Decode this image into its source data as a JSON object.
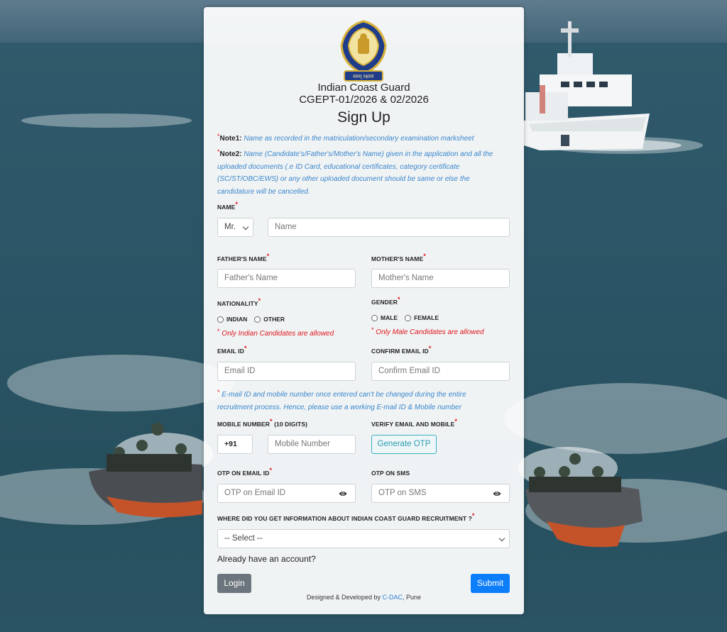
{
  "header": {
    "org_name": "Indian Coast Guard",
    "exam_code": "CGEPT-01/2026 & 02/2026",
    "title": "Sign Up",
    "emblem_text": "वयम् रक्षामः"
  },
  "notes": {
    "note1_label": "Note1:",
    "note1_text": "Name as recorded in the matriculation/secondary examination marksheet",
    "note2_label": "Note2:",
    "note2_line1": "Name (Candidate's/Father's/Mother's Name) given in the application and all the",
    "note2_line2": "uploaded documents (.e ID Card, educational certificates, category certificate",
    "note2_line3": "(SC/ST/OBC/EWS) or any other uploaded document should be same or else the",
    "note2_line4": "candidature will be cancelled."
  },
  "form": {
    "required_mark": "*",
    "name_label": "NAME",
    "title_select_value": "Mr.",
    "name_placeholder": "Name",
    "father_label": "FATHER'S NAME",
    "father_placeholder": "Father's Name",
    "mother_label": "MOTHER'S NAME",
    "mother_placeholder": "Mother's Name",
    "nationality_label": "NATIONALITY",
    "nationality_options": [
      "INDIAN",
      "OTHER"
    ],
    "nationality_warning": "Only Indian Candidates are allowed",
    "gender_label": "GENDER",
    "gender_options": [
      "MALE",
      "FEMALE"
    ],
    "gender_warning": "Only Male Candidates are allowed",
    "email_label": "EMAIL ID",
    "email_placeholder": "Email ID",
    "confirm_email_label": "CONFIRM EMAIL ID",
    "confirm_email_placeholder": "Confirm Email ID",
    "info_line1": "E-mail ID and mobile number once entered can't be changed during the entire",
    "info_line2": "recruitment process. Hence, please use a working E-mail ID & Mobile number",
    "mobile_label": "MOBILE NUMBER",
    "mobile_label_suffix": "(10 DIGITS)",
    "country_code": "+91",
    "mobile_placeholder": "Mobile Number",
    "verify_label": "VERIFY EMAIL AND MOBILE",
    "generate_otp_label": "Generate OTP",
    "otp_email_label": "OTP ON EMAIL ID",
    "otp_email_placeholder": "OTP on Email ID",
    "otp_sms_label": "OTP ON SMS",
    "otp_sms_placeholder": "OTP on SMS",
    "source_label": "WHERE DID YOU GET INFORMATION ABOUT INDIAN COAST GUARD RECRUITMENT ?",
    "source_select_value": "-- Select --"
  },
  "actions": {
    "account_prompt": "Already have an account?",
    "login_label": "Login",
    "submit_label": "Submit"
  },
  "footer": {
    "prefix": "Designed & Developed by ",
    "link": "C-DAC",
    "suffix": ", Pune"
  },
  "colors": {
    "accent_blue": "#0d7ef9",
    "info_blue": "#3a86cc",
    "required_red": "#e0161b",
    "login_gray": "#6c757d"
  }
}
